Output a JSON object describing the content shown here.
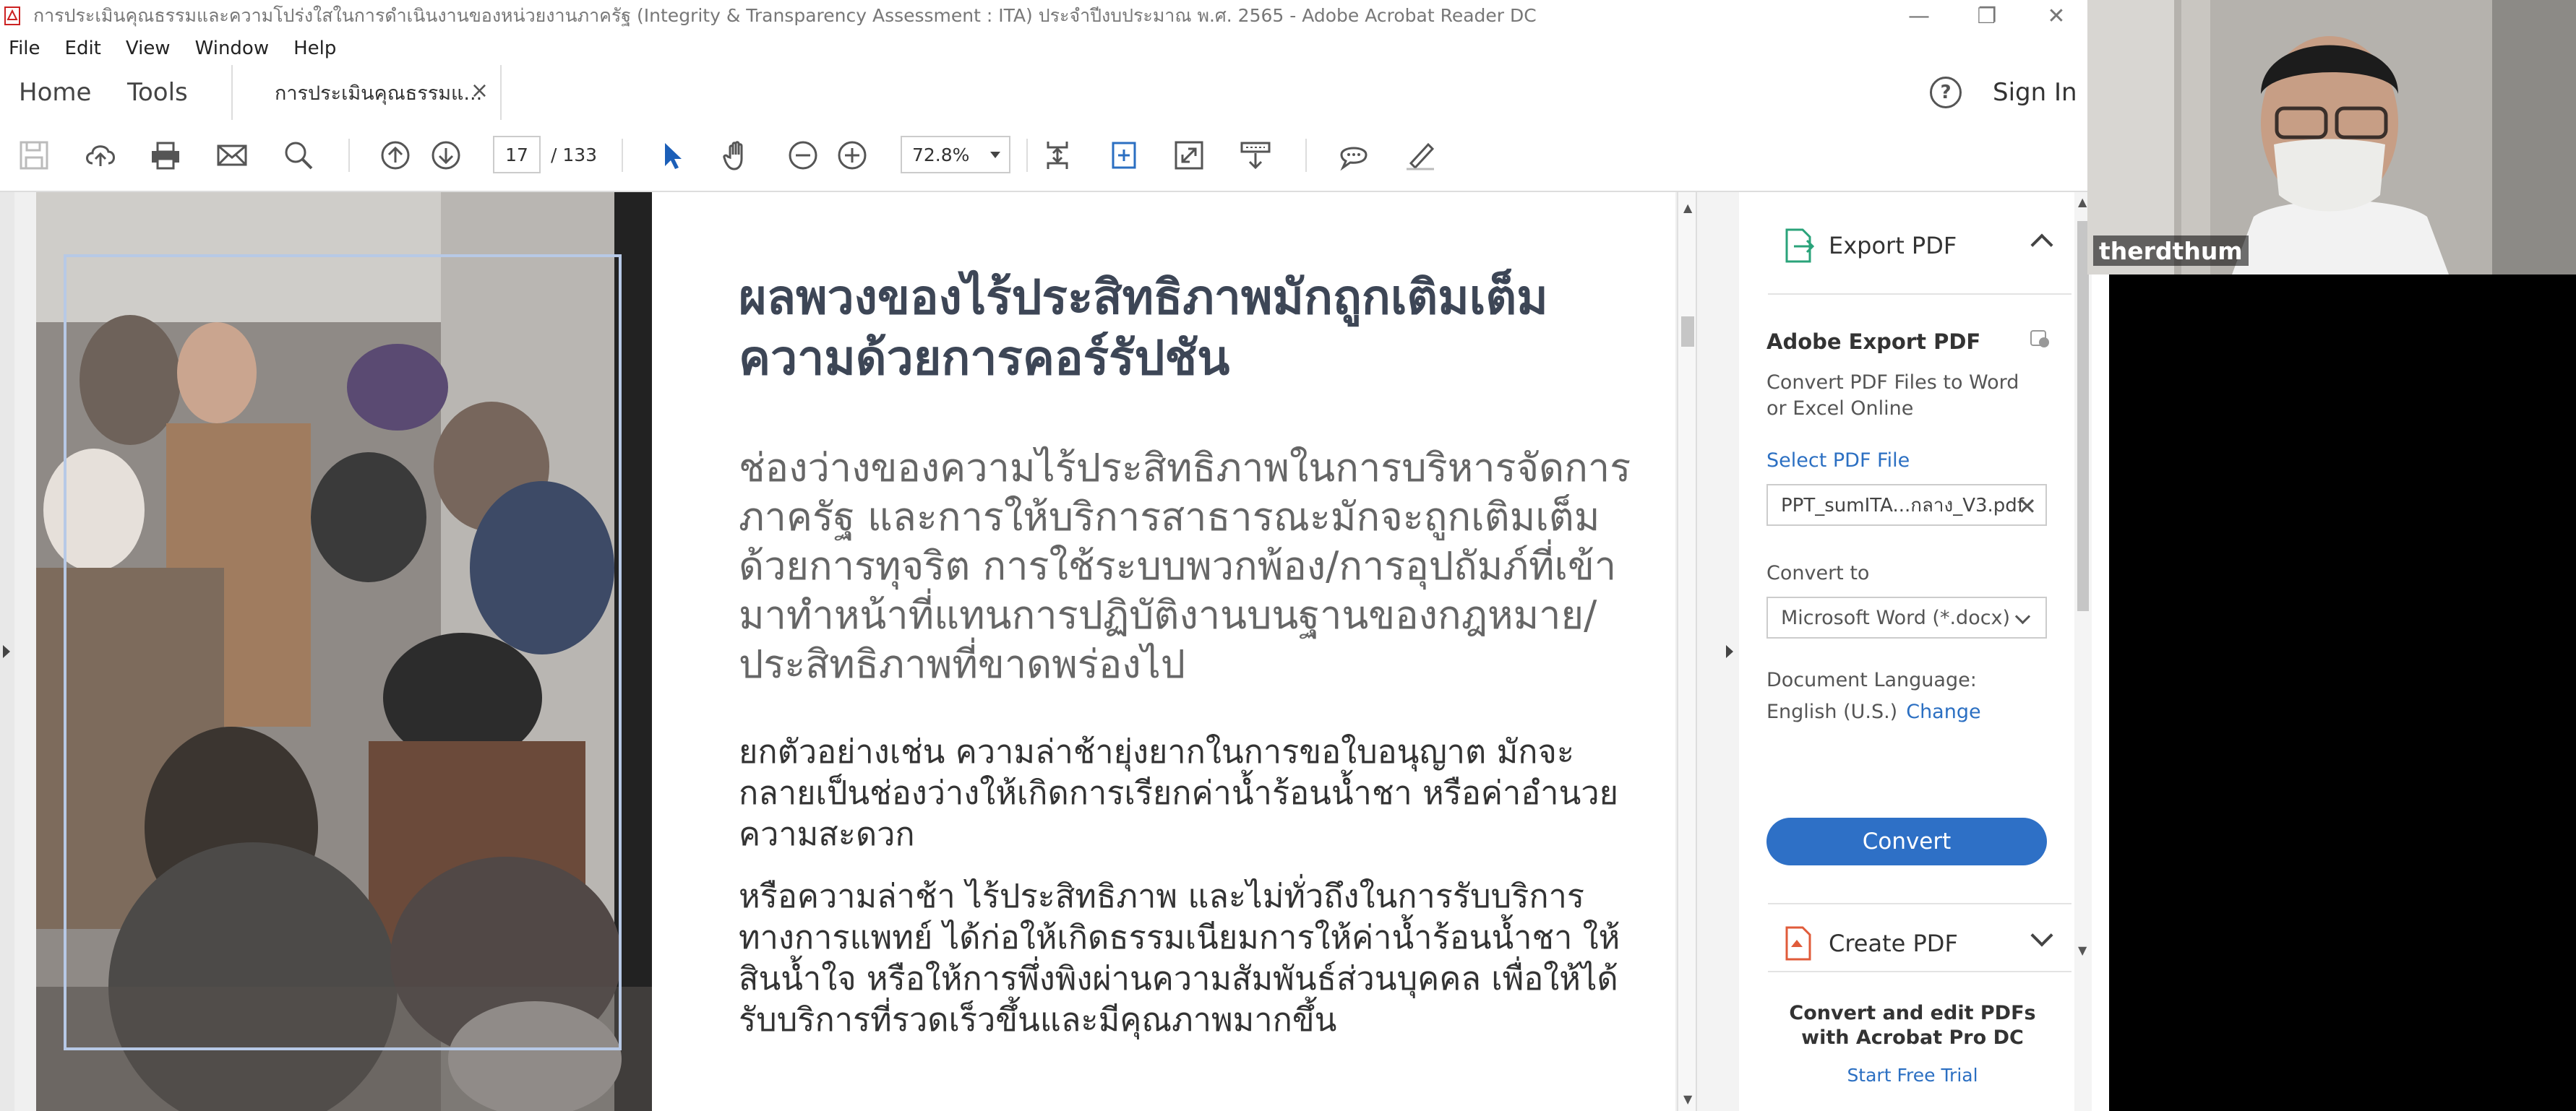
{
  "window": {
    "title": "การประเมินคุณธรรมและความโปร่งใสในการดำเนินงานของหน่วยงานภาครัฐ (Integrity & Transparency Assessment : ITA) ประจำปีงบประมาณ พ.ศ. 2565 - Adobe Acrobat Reader DC",
    "controls": {
      "minimize": "—",
      "restore": "❐",
      "close": "✕"
    }
  },
  "menu": [
    "File",
    "Edit",
    "View",
    "Window",
    "Help"
  ],
  "tabs": {
    "home": "Home",
    "tools": "Tools",
    "document": "การประเมินคุณธรรมแ...",
    "close": "×",
    "help": "?",
    "sign_in": "Sign In"
  },
  "toolbar": {
    "page_current": "17",
    "page_total": "/  133",
    "zoom": "72.8%",
    "icons": [
      "save-icon",
      "upload-icon",
      "print-icon",
      "email-icon",
      "search-icon",
      "page-up-icon",
      "page-down-icon",
      "select-cursor-icon",
      "hand-icon",
      "zoom-out-icon",
      "zoom-in-icon",
      "fit-page-icon",
      "rotate-icon",
      "full-screen-icon",
      "scroll-mode-icon",
      "comment-icon",
      "highlight-pen-icon"
    ]
  },
  "document": {
    "heading": "ผลพวงของไร้ประสิทธิภาพมักถูกเติมเต็มความด้วยการคอร์รัปชัน",
    "paragraph1": "ช่องว่างของความไร้ประสิทธิภาพในการบริหารจัดการภาครัฐ และการให้บริการสาธารณะมักจะถูกเติมเต็มด้วยการทุจริต การใช้ระบบพวกพ้อง/การอุปถัมภ์ที่เข้ามาทำหน้าที่แทนการปฏิบัติงานบนฐานของกฎหมาย/ประสิทธิภาพที่ขาดพร่องไป",
    "paragraph2": "ยกตัวอย่างเช่น ความล่าช้ายุ่งยากในการขอใบอนุญาต มักจะกลายเป็นช่องว่างให้เกิดการเรียกค่าน้ำร้อนน้ำชา หรือค่าอำนวยความสะดวก",
    "paragraph3": "หรือความล่าช้า ไร้ประสิทธิภาพ และไม่ทั่วถึงในการรับบริการทางการแพทย์ ได้ก่อให้เกิดธรรมเนียมการให้ค่าน้ำร้อนน้ำชา ให้สินน้ำใจ หรือให้การพึ่งพิงผ่านความสัมพันธ์ส่วนบุคคล เพื่อให้ได้รับบริการที่รวดเร็วขึ้นและมีคุณภาพมากขึ้น"
  },
  "export_panel": {
    "header": "Export PDF",
    "title": "Adobe Export PDF",
    "description": "Convert PDF Files to Word or Excel Online",
    "select_file": "Select PDF File",
    "file_name": "PPT_sumITA...กลาง_V3.pdf",
    "convert_to_label": "Convert to",
    "format": "Microsoft Word (*.docx)",
    "doc_language_label": "Document Language:",
    "language": "English (U.S.)",
    "change": "Change",
    "convert_button": "Convert"
  },
  "create_panel": {
    "header": "Create PDF",
    "promo": "Convert and edit PDFs with Acrobat Pro DC",
    "trial": "Start Free Trial"
  },
  "video": {
    "participant": "therdthum"
  },
  "colors": {
    "accent": "#2e70c6",
    "link": "#2b6fc2",
    "heading": "#3d4656",
    "create_icon": "#e05b3a",
    "export_icon": "#2aa37a"
  }
}
